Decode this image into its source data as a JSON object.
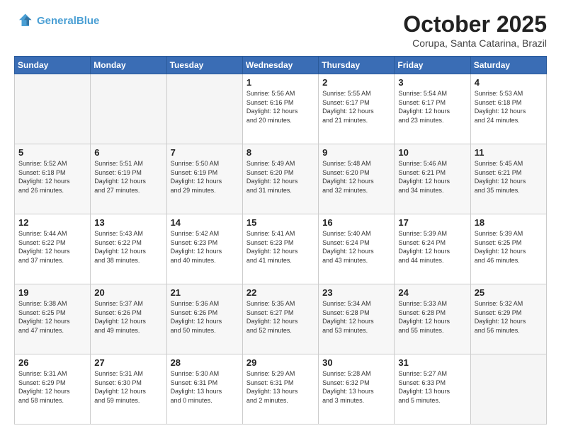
{
  "header": {
    "logo_line1": "General",
    "logo_line2": "Blue",
    "month_title": "October 2025",
    "subtitle": "Corupa, Santa Catarina, Brazil"
  },
  "weekdays": [
    "Sunday",
    "Monday",
    "Tuesday",
    "Wednesday",
    "Thursday",
    "Friday",
    "Saturday"
  ],
  "weeks": [
    [
      {
        "day": "",
        "info": ""
      },
      {
        "day": "",
        "info": ""
      },
      {
        "day": "",
        "info": ""
      },
      {
        "day": "1",
        "info": "Sunrise: 5:56 AM\nSunset: 6:16 PM\nDaylight: 12 hours\nand 20 minutes."
      },
      {
        "day": "2",
        "info": "Sunrise: 5:55 AM\nSunset: 6:17 PM\nDaylight: 12 hours\nand 21 minutes."
      },
      {
        "day": "3",
        "info": "Sunrise: 5:54 AM\nSunset: 6:17 PM\nDaylight: 12 hours\nand 23 minutes."
      },
      {
        "day": "4",
        "info": "Sunrise: 5:53 AM\nSunset: 6:18 PM\nDaylight: 12 hours\nand 24 minutes."
      }
    ],
    [
      {
        "day": "5",
        "info": "Sunrise: 5:52 AM\nSunset: 6:18 PM\nDaylight: 12 hours\nand 26 minutes."
      },
      {
        "day": "6",
        "info": "Sunrise: 5:51 AM\nSunset: 6:19 PM\nDaylight: 12 hours\nand 27 minutes."
      },
      {
        "day": "7",
        "info": "Sunrise: 5:50 AM\nSunset: 6:19 PM\nDaylight: 12 hours\nand 29 minutes."
      },
      {
        "day": "8",
        "info": "Sunrise: 5:49 AM\nSunset: 6:20 PM\nDaylight: 12 hours\nand 31 minutes."
      },
      {
        "day": "9",
        "info": "Sunrise: 5:48 AM\nSunset: 6:20 PM\nDaylight: 12 hours\nand 32 minutes."
      },
      {
        "day": "10",
        "info": "Sunrise: 5:46 AM\nSunset: 6:21 PM\nDaylight: 12 hours\nand 34 minutes."
      },
      {
        "day": "11",
        "info": "Sunrise: 5:45 AM\nSunset: 6:21 PM\nDaylight: 12 hours\nand 35 minutes."
      }
    ],
    [
      {
        "day": "12",
        "info": "Sunrise: 5:44 AM\nSunset: 6:22 PM\nDaylight: 12 hours\nand 37 minutes."
      },
      {
        "day": "13",
        "info": "Sunrise: 5:43 AM\nSunset: 6:22 PM\nDaylight: 12 hours\nand 38 minutes."
      },
      {
        "day": "14",
        "info": "Sunrise: 5:42 AM\nSunset: 6:23 PM\nDaylight: 12 hours\nand 40 minutes."
      },
      {
        "day": "15",
        "info": "Sunrise: 5:41 AM\nSunset: 6:23 PM\nDaylight: 12 hours\nand 41 minutes."
      },
      {
        "day": "16",
        "info": "Sunrise: 5:40 AM\nSunset: 6:24 PM\nDaylight: 12 hours\nand 43 minutes."
      },
      {
        "day": "17",
        "info": "Sunrise: 5:39 AM\nSunset: 6:24 PM\nDaylight: 12 hours\nand 44 minutes."
      },
      {
        "day": "18",
        "info": "Sunrise: 5:39 AM\nSunset: 6:25 PM\nDaylight: 12 hours\nand 46 minutes."
      }
    ],
    [
      {
        "day": "19",
        "info": "Sunrise: 5:38 AM\nSunset: 6:25 PM\nDaylight: 12 hours\nand 47 minutes."
      },
      {
        "day": "20",
        "info": "Sunrise: 5:37 AM\nSunset: 6:26 PM\nDaylight: 12 hours\nand 49 minutes."
      },
      {
        "day": "21",
        "info": "Sunrise: 5:36 AM\nSunset: 6:26 PM\nDaylight: 12 hours\nand 50 minutes."
      },
      {
        "day": "22",
        "info": "Sunrise: 5:35 AM\nSunset: 6:27 PM\nDaylight: 12 hours\nand 52 minutes."
      },
      {
        "day": "23",
        "info": "Sunrise: 5:34 AM\nSunset: 6:28 PM\nDaylight: 12 hours\nand 53 minutes."
      },
      {
        "day": "24",
        "info": "Sunrise: 5:33 AM\nSunset: 6:28 PM\nDaylight: 12 hours\nand 55 minutes."
      },
      {
        "day": "25",
        "info": "Sunrise: 5:32 AM\nSunset: 6:29 PM\nDaylight: 12 hours\nand 56 minutes."
      }
    ],
    [
      {
        "day": "26",
        "info": "Sunrise: 5:31 AM\nSunset: 6:29 PM\nDaylight: 12 hours\nand 58 minutes."
      },
      {
        "day": "27",
        "info": "Sunrise: 5:31 AM\nSunset: 6:30 PM\nDaylight: 12 hours\nand 59 minutes."
      },
      {
        "day": "28",
        "info": "Sunrise: 5:30 AM\nSunset: 6:31 PM\nDaylight: 13 hours\nand 0 minutes."
      },
      {
        "day": "29",
        "info": "Sunrise: 5:29 AM\nSunset: 6:31 PM\nDaylight: 13 hours\nand 2 minutes."
      },
      {
        "day": "30",
        "info": "Sunrise: 5:28 AM\nSunset: 6:32 PM\nDaylight: 13 hours\nand 3 minutes."
      },
      {
        "day": "31",
        "info": "Sunrise: 5:27 AM\nSunset: 6:33 PM\nDaylight: 13 hours\nand 5 minutes."
      },
      {
        "day": "",
        "info": ""
      }
    ]
  ]
}
